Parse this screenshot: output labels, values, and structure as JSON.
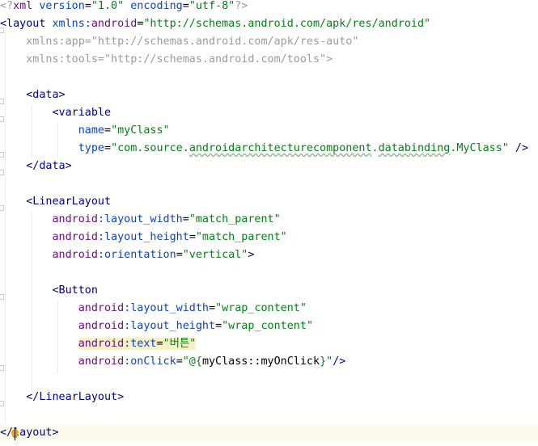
{
  "editor": {
    "lines": [
      [
        [
          "bp",
          "<?"
        ],
        [
          "pre",
          "xml "
        ],
        [
          "attr",
          "version"
        ],
        [
          "plain",
          "="
        ],
        [
          "val",
          "\"1.0\""
        ],
        [
          "plain",
          " "
        ],
        [
          "attr",
          "encoding"
        ],
        [
          "plain",
          "="
        ],
        [
          "val",
          "\"utf-8\""
        ],
        [
          "bp",
          "?>"
        ]
      ],
      [
        [
          "tag",
          "<layout "
        ],
        [
          "attr",
          "xmlns:"
        ],
        [
          "pre",
          "android"
        ],
        [
          "plain",
          "="
        ],
        [
          "val",
          "\"http://schemas.android.com/apk/res/android\""
        ]
      ],
      [
        [
          "plain",
          "    "
        ],
        [
          "bp",
          "xmlns:app=\"http://schemas.android.com/apk/res-auto\""
        ]
      ],
      [
        [
          "plain",
          "    "
        ],
        [
          "bp",
          "xmlns:tools=\"http://schemas.android.com/tools\">"
        ]
      ],
      [],
      [
        [
          "plain",
          "    "
        ],
        [
          "tag",
          "<data>"
        ]
      ],
      [
        [
          "plain",
          "        "
        ],
        [
          "tag",
          "<variable"
        ]
      ],
      [
        [
          "plain",
          "            "
        ],
        [
          "attr",
          "name"
        ],
        [
          "plain",
          "="
        ],
        [
          "val",
          "\"myClass\""
        ]
      ],
      [
        [
          "plain",
          "            "
        ],
        [
          "attr",
          "type"
        ],
        [
          "plain",
          "="
        ],
        [
          "val",
          "\"com.source."
        ],
        [
          "pkg",
          "androidarchitecturecomponent"
        ],
        [
          "val",
          "."
        ],
        [
          "pkg",
          "databinding"
        ],
        [
          "val",
          ".MyClass\""
        ],
        [
          "plain",
          " "
        ],
        [
          "tag",
          "/>"
        ]
      ],
      [
        [
          "plain",
          "    "
        ],
        [
          "tag",
          "</data>"
        ]
      ],
      [],
      [
        [
          "plain",
          "    "
        ],
        [
          "tag",
          "<LinearLayout"
        ]
      ],
      [
        [
          "plain",
          "        "
        ],
        [
          "pre",
          "android"
        ],
        [
          "attr",
          ":layout_width"
        ],
        [
          "plain",
          "="
        ],
        [
          "val",
          "\"match_parent\""
        ]
      ],
      [
        [
          "plain",
          "        "
        ],
        [
          "pre",
          "android"
        ],
        [
          "attr",
          ":layout_height"
        ],
        [
          "plain",
          "="
        ],
        [
          "val",
          "\"match_parent\""
        ]
      ],
      [
        [
          "plain",
          "        "
        ],
        [
          "pre",
          "android"
        ],
        [
          "attr",
          ":orientation"
        ],
        [
          "plain",
          "="
        ],
        [
          "val",
          "\"vertical\""
        ],
        [
          "tag",
          ">"
        ]
      ],
      [],
      [
        [
          "plain",
          "        "
        ],
        [
          "tag",
          "<Button"
        ]
      ],
      [
        [
          "plain",
          "            "
        ],
        [
          "pre",
          "android"
        ],
        [
          "attr",
          ":layout_width"
        ],
        [
          "plain",
          "="
        ],
        [
          "val",
          "\"wrap_content\""
        ]
      ],
      [
        [
          "plain",
          "            "
        ],
        [
          "pre",
          "android"
        ],
        [
          "attr",
          ":layout_height"
        ],
        [
          "plain",
          "="
        ],
        [
          "val",
          "\"wrap_content\""
        ]
      ],
      [
        [
          "plain",
          "            "
        ],
        [
          "hl:pre",
          "android"
        ],
        [
          "hl:attr",
          ":text"
        ],
        [
          "hl:plain",
          "="
        ],
        [
          "hl:val",
          "\"버튼\""
        ]
      ],
      [
        [
          "plain",
          "            "
        ],
        [
          "pre",
          "android"
        ],
        [
          "attr",
          ":onClick"
        ],
        [
          "plain",
          "="
        ],
        [
          "val",
          "\"@{"
        ],
        [
          "plain",
          "myClass::myOnClick"
        ],
        [
          "val",
          "}\""
        ],
        [
          "tag",
          "/>"
        ]
      ],
      [],
      [
        [
          "plain",
          "    "
        ],
        [
          "tag",
          "</LinearLayout>"
        ]
      ],
      [],
      [
        [
          "tag",
          "</layout>"
        ]
      ]
    ]
  }
}
